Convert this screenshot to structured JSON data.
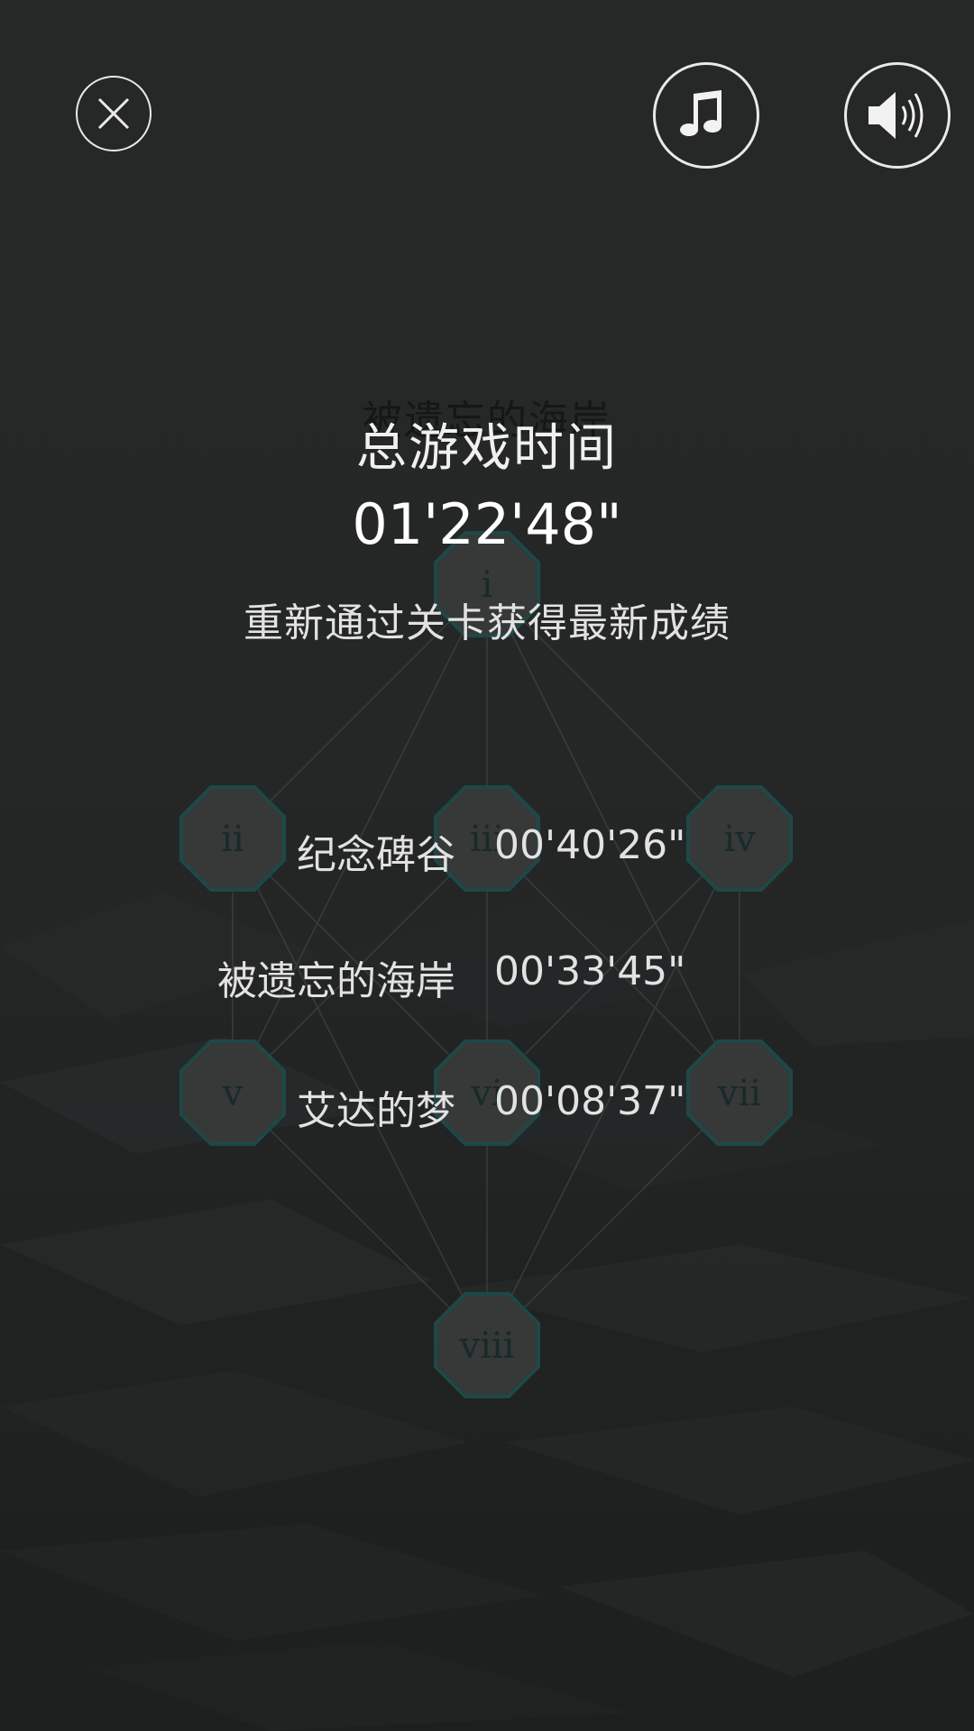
{
  "header": {
    "close_icon": "close-icon",
    "music_icon": "music-note-icon",
    "sound_icon": "speaker-volume-icon"
  },
  "ghost_title": "被遗忘的海岸",
  "summary": {
    "label": "总游戏时间",
    "total_time": "01'22'48\"",
    "hint": "重新通过关卡获得最新成绩"
  },
  "levels": [
    {
      "name": "纪念碑谷",
      "time": "00'40'26\""
    },
    {
      "name": "被遗忘的海岸",
      "time": "00'33'45\""
    },
    {
      "name": "艾达的梦",
      "time": "00'08'37\""
    }
  ],
  "map": {
    "nodes": [
      "i",
      "ii",
      "iii",
      "iv",
      "v",
      "vi",
      "vii",
      "viii"
    ],
    "node_color": "#454545",
    "node_border": "#1f5f5c"
  }
}
